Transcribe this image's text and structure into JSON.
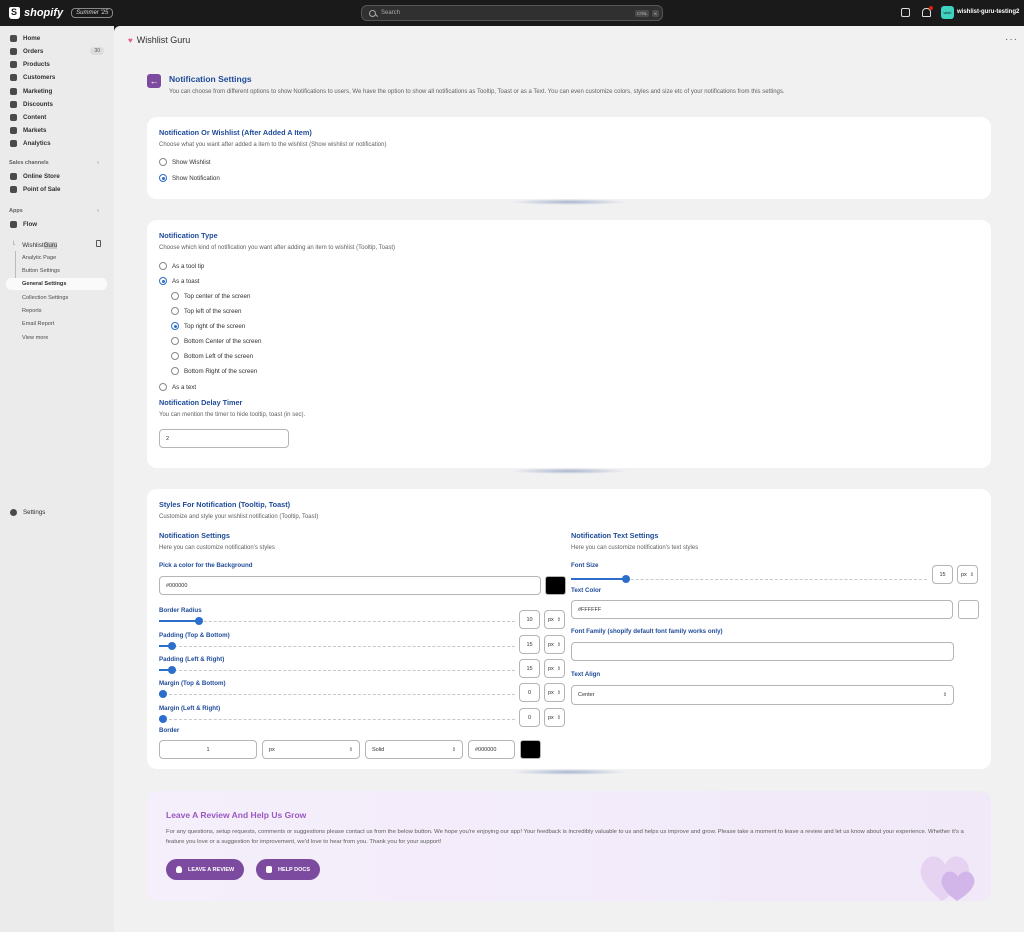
{
  "topbar": {
    "brand": "shopify",
    "edition": "Summer '25",
    "search_placeholder": "Search",
    "kbd1": "CTRL",
    "kbd2": "K",
    "store_name": "wishlist-guru-testing2",
    "store_avatar": "wish"
  },
  "sidebar": {
    "items": [
      {
        "label": "Home",
        "icon": "home-icon"
      },
      {
        "label": "Orders",
        "icon": "orders-icon",
        "badge": "30"
      },
      {
        "label": "Products",
        "icon": "tag-icon"
      },
      {
        "label": "Customers",
        "icon": "person-icon"
      },
      {
        "label": "Marketing",
        "icon": "target-icon"
      },
      {
        "label": "Discounts",
        "icon": "discount-icon"
      },
      {
        "label": "Content",
        "icon": "content-icon"
      },
      {
        "label": "Markets",
        "icon": "globe-icon"
      },
      {
        "label": "Analytics",
        "icon": "chart-icon"
      }
    ],
    "sales_channels_label": "Sales channels",
    "channels": [
      {
        "label": "Online Store",
        "icon": "store-icon"
      },
      {
        "label": "Point of Sale",
        "icon": "pos-icon"
      }
    ],
    "apps_label": "Apps",
    "apps": [
      {
        "label": "Flow",
        "icon": "flow-icon"
      }
    ],
    "wishlist_app": {
      "label_prefix": "Wishlist ",
      "label_highlight": "Guru"
    },
    "subitems": [
      "Analytic Page",
      "Button Settings",
      "General Settings",
      "Collection Settings",
      "Reports",
      "Email Report",
      "View more"
    ],
    "active_subitem": "General Settings",
    "settings_label": "Settings"
  },
  "app_header": {
    "title": "Wishlist Guru"
  },
  "page": {
    "title": "Notification Settings",
    "description": "You can choose from different options to show Notifications to users, We have the option to show all notifications as Tooltip, Toast or as a Text. You can even customize colors, styles and size etc of your notifications from this settings."
  },
  "card1": {
    "title": "Notification Or Wishlist (After Added A Item)",
    "description": "Choose what you want after added a item to the wishlist (Show wishlist or notification)",
    "options": [
      "Show Wishlist",
      "Show Notification"
    ],
    "selected": 1
  },
  "card2": {
    "title": "Notification Type",
    "description": "Choose which kind of notification you want after adding an item to wishlist (Tooltip, Toast)",
    "opt_tooltip": "As a tool tip",
    "opt_toast": "As a toast",
    "toast_positions": [
      "Top center of the screen",
      "Top left of the screen",
      "Top right of the screen",
      "Bottom Center of the screen",
      "Bottom Left of the screen",
      "Bottom Right of the screen"
    ],
    "toast_selected": 2,
    "opt_text": "As a text",
    "timer_title": "Notification Delay Timer",
    "timer_description": "You can mention the timer to hide tooltip, toast (in sec).",
    "timer_value": "2"
  },
  "card3": {
    "title": "Styles For Notification (Tooltip, Toast)",
    "description": "Customize and style your wishlist notification (Tooltip, Toast)",
    "left": {
      "title": "Notification Settings",
      "description": "Here you can customize notification's styles",
      "bg_label": "Pick a color for the Background",
      "bg_value": "#000000",
      "bg_color": "#000000",
      "sliders": [
        {
          "label": "Border Radius",
          "value": "10",
          "unit": "px",
          "fraction": 0.1
        },
        {
          "label": "Padding (Top & Bottom)",
          "value": "15",
          "unit": "px",
          "fraction": 0.025
        },
        {
          "label": "Padding (Left & Right)",
          "value": "15",
          "unit": "px",
          "fraction": 0.025
        },
        {
          "label": "Margin (Top & Bottom)",
          "value": "0",
          "unit": "px",
          "fraction": 0
        },
        {
          "label": "Margin (Left & Right)",
          "value": "0",
          "unit": "px",
          "fraction": 0
        }
      ],
      "border_label": "Border",
      "border_width": "1",
      "border_unit": "px",
      "border_style": "Solid",
      "border_color_value": "#000000",
      "border_color": "#000000"
    },
    "right": {
      "title": "Notification Text Settings",
      "description": "Here you can customize notification's text styles",
      "font_size_label": "Font Size",
      "font_size_value": "15",
      "font_size_unit": "px",
      "font_size_fraction": 0.155,
      "text_color_label": "Text Color",
      "text_color_value": "#FFFFFF",
      "text_color": "#FFFFFF",
      "font_family_label": "Font Family (shopify default font family works only)",
      "font_family_value": "",
      "text_align_label": "Text Align",
      "text_align_value": "Center"
    }
  },
  "review": {
    "title": "Leave A Review And Help Us Grow",
    "description": "For any questions, setup requests, comments or suggestions please contact us from the below button. We hope you're enjoying our app! Your feedback is incredibly valuable to us and helps us improve and grow. Please take a moment to leave a review and let us know about your experience. Whether it's a feature you love or a suggestion for improvement, we'd love to hear from you. Thank you for your support!",
    "btn_review": "LEAVE A REVIEW",
    "btn_docs": "HELP DOCS"
  },
  "colors": {
    "accent": "#7c4a9e",
    "heading": "#1f4b99",
    "radio": "#2c6ecb"
  }
}
